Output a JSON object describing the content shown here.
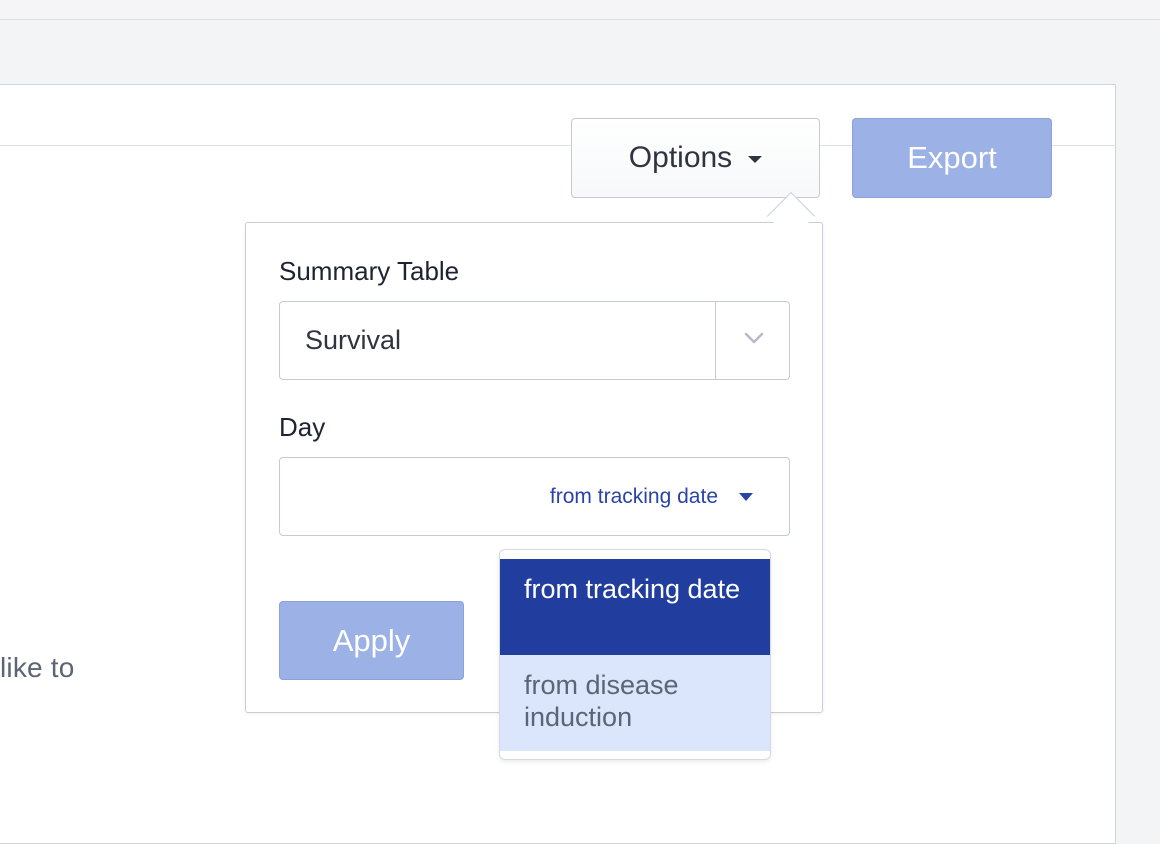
{
  "background": {
    "truncated_text": "like to"
  },
  "toolbar": {
    "options_label": "Options",
    "export_label": "Export"
  },
  "options_popover": {
    "summary_table": {
      "label": "Summary Table",
      "selected_value": "Survival"
    },
    "day": {
      "label": "Day",
      "selected_value": "from tracking date",
      "options": [
        {
          "label": "from tracking date",
          "selected": true
        },
        {
          "label": "from disease induction",
          "selected": false
        }
      ]
    },
    "apply_label": "Apply"
  },
  "colors": {
    "accent": "#213e9f",
    "button_disabled": "#9cb1e6",
    "option_hover": "#dbe5fb",
    "link_text": "#2a44a6"
  },
  "icons": {
    "options_caret": "caret-down-icon",
    "select_chevron": "chevron-down-icon",
    "day_caret": "caret-down-icon"
  }
}
